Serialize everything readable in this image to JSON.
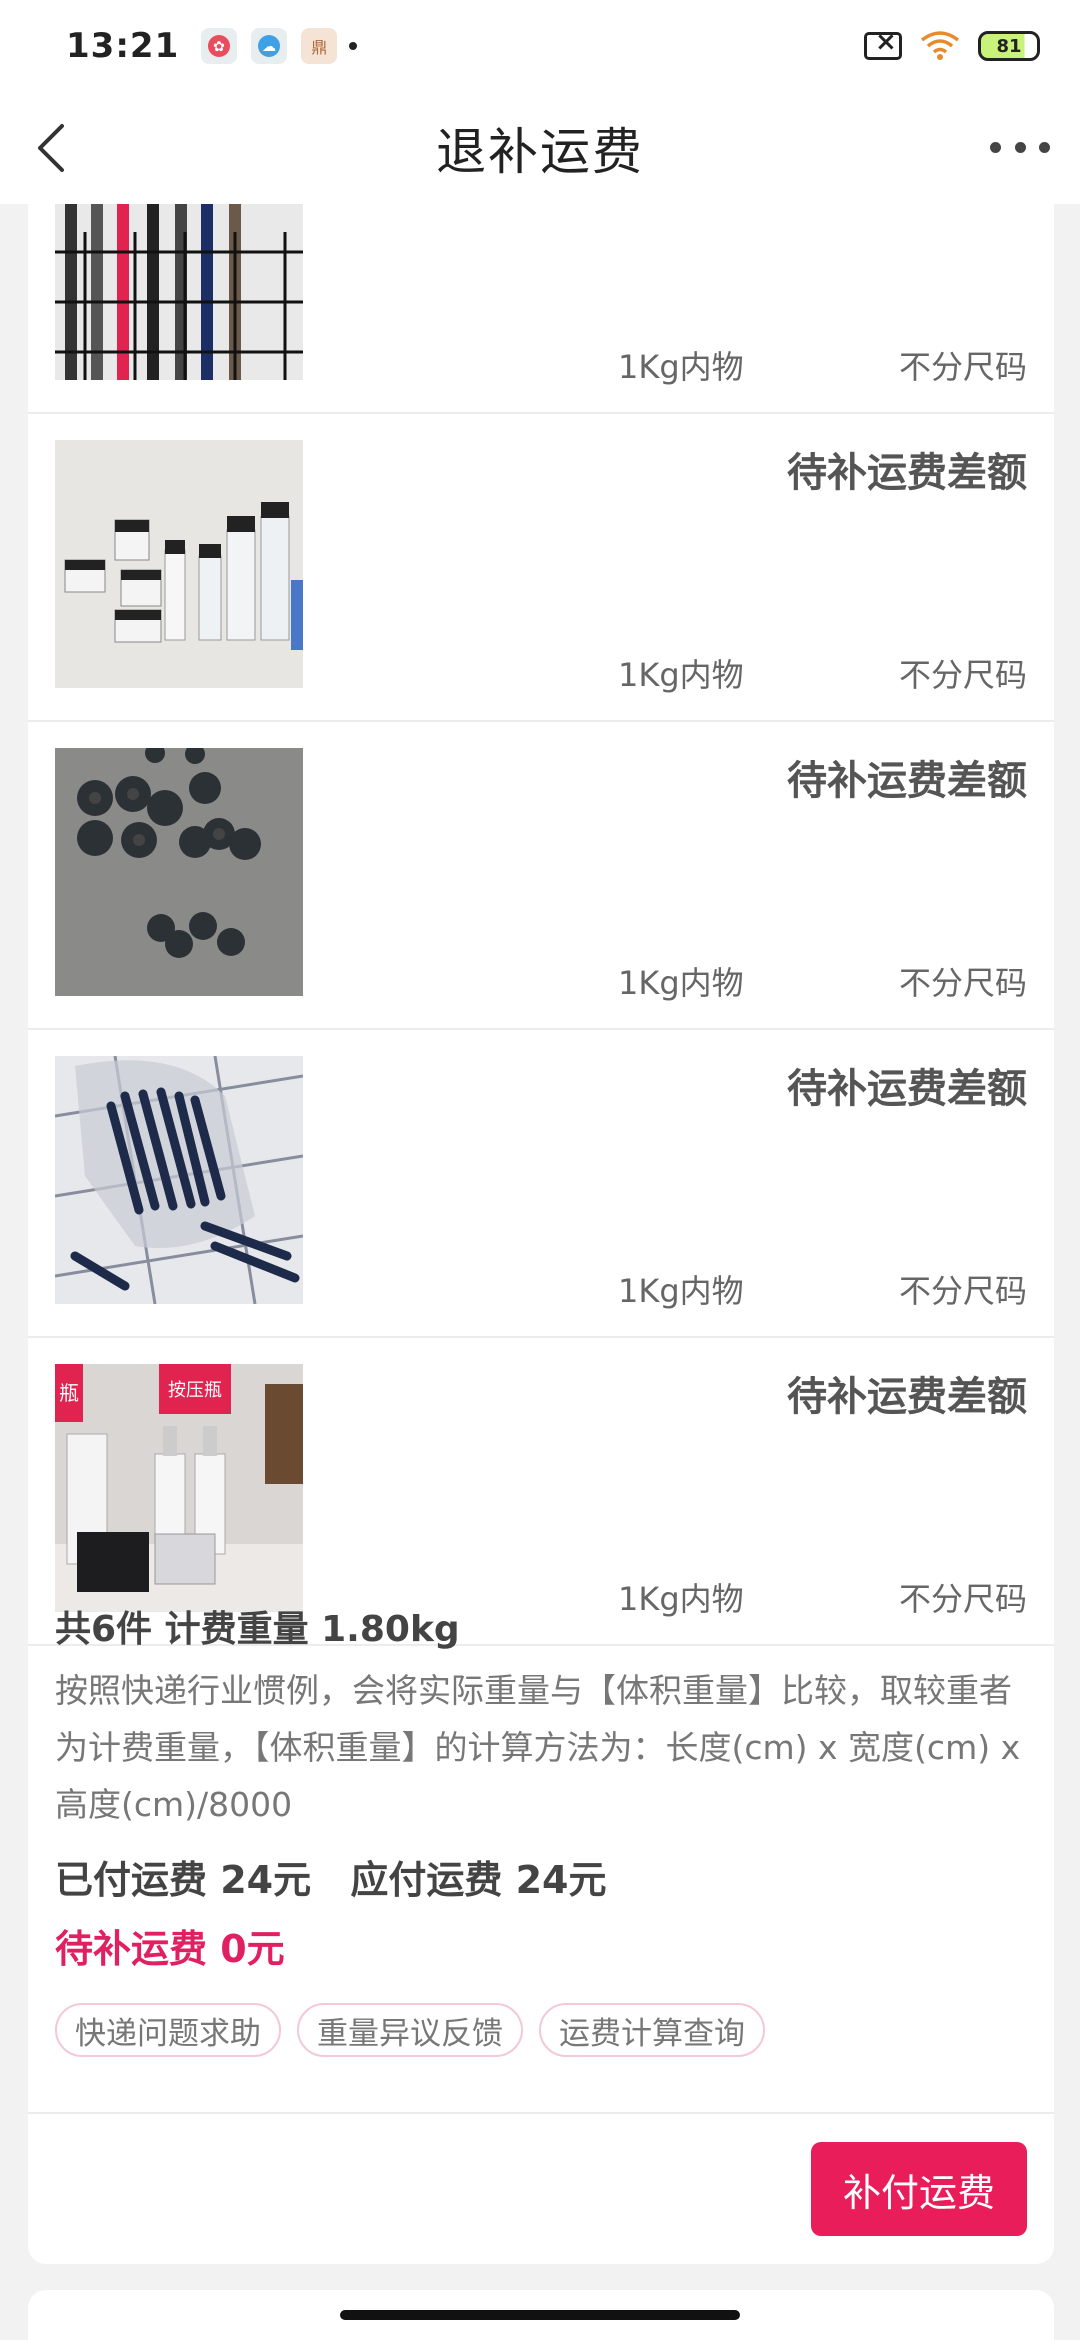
{
  "status_bar": {
    "time": "13:21",
    "battery": "81",
    "app_icons": [
      {
        "name": "weibo-app-icon",
        "color": "#e84c5d",
        "glyph": "✿"
      },
      {
        "name": "cloud-app-icon",
        "color": "#3fa0e6",
        "glyph": "☁"
      },
      {
        "name": "shop-app-icon",
        "color": "#f5d9c8",
        "glyph": "鼎"
      }
    ]
  },
  "nav": {
    "title": "退补运费"
  },
  "items": [
    {
      "status": "",
      "weight": "1Kg内物",
      "size": "不分尺码"
    },
    {
      "status": "待补运费差额",
      "weight": "1Kg内物",
      "size": "不分尺码"
    },
    {
      "status": "待补运费差额",
      "weight": "1Kg内物",
      "size": "不分尺码"
    },
    {
      "status": "待补运费差额",
      "weight": "1Kg内物",
      "size": "不分尺码"
    },
    {
      "status": "待补运费差额",
      "weight": "1Kg内物",
      "size": "不分尺码",
      "photo_labels": [
        "瓶",
        "按压瓶"
      ]
    }
  ],
  "summary": {
    "headline": "共6件 计费重量 1.80kg",
    "description": "按照快递行业惯例，会将实际重量与【体积重量】比较，取较重者为计费重量，【体积重量】的计算方法为：长度(cm) x 宽度(cm) x 高度(cm)/8000",
    "paid": "已付运费 24元",
    "due": "应付运费 24元",
    "owed": "待补运费 0元",
    "tags": [
      "快递问题求助",
      "重量异议反馈",
      "运费计算查询"
    ]
  },
  "actions": {
    "pay_button": "补付运费"
  },
  "colors": {
    "accent": "#e81d5a",
    "owed_text": "#e02060"
  }
}
